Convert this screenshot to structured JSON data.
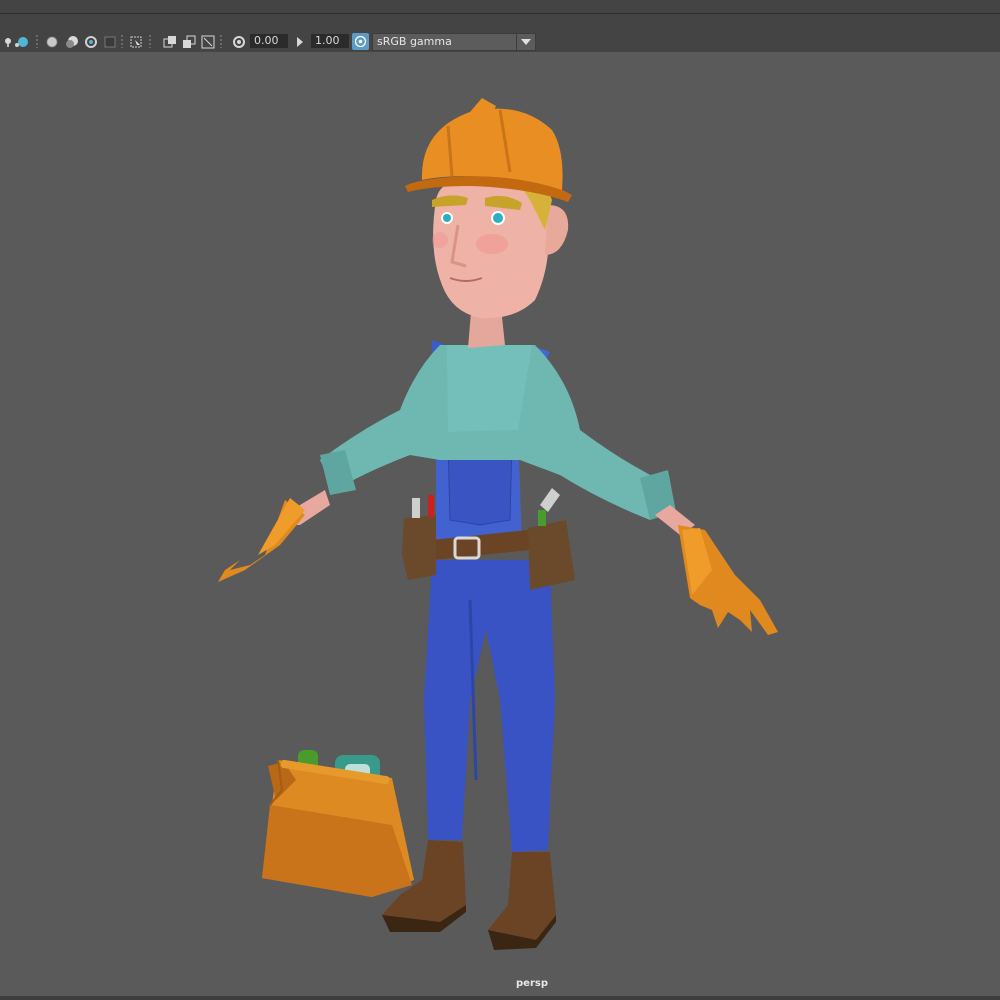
{
  "toolbar": {
    "exposure_value": "0.00",
    "gamma_value": "1.00",
    "color_space": "sRGB gamma",
    "icons": [
      "light-bulb-icon",
      "shading-sphere-icon",
      "dotted-sphere-icon",
      "shadow-sphere-icon",
      "ambient-occlusion-icon",
      "motion-blur-icon",
      "grid-icon",
      "isolate-select-icon",
      "resolution-gate-icon",
      "gate-mask-icon",
      "film-gate-icon",
      "exposure-icon",
      "gamma-icon",
      "color-management-icon",
      "dropdown-arrow-icon"
    ]
  },
  "viewport": {
    "camera_label": "persp",
    "background_color": "#5a5a5a",
    "subject": "construction-worker-character-model"
  }
}
